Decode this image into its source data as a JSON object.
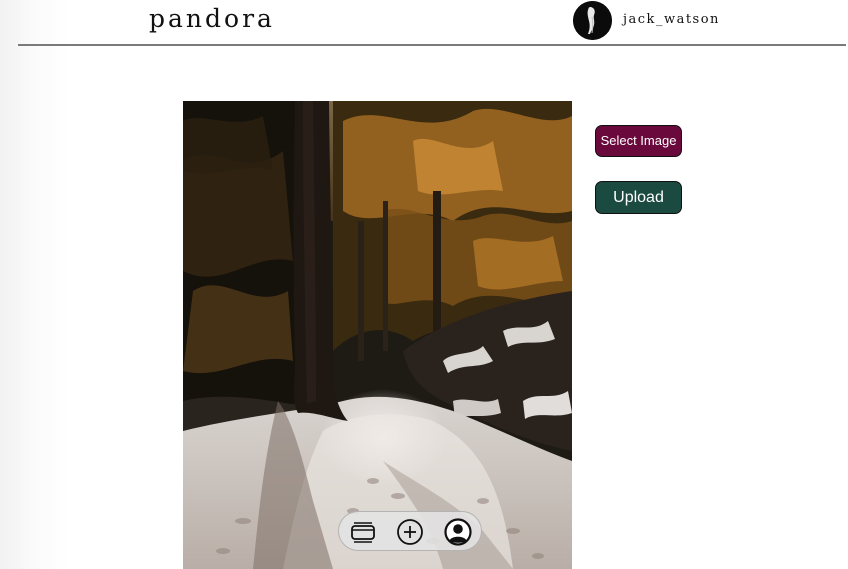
{
  "header": {
    "brand": "pandora",
    "username": "jack_watson"
  },
  "actions": {
    "select_image_label": "Select Image",
    "upload_label": "Upload"
  },
  "nav": {
    "icons": [
      "feed-icon",
      "add-post-icon",
      "profile-icon"
    ]
  },
  "colors": {
    "select_button": "#6a0a3c",
    "upload_button": "#1a4a40",
    "header_rule": "#7a7a7a"
  }
}
